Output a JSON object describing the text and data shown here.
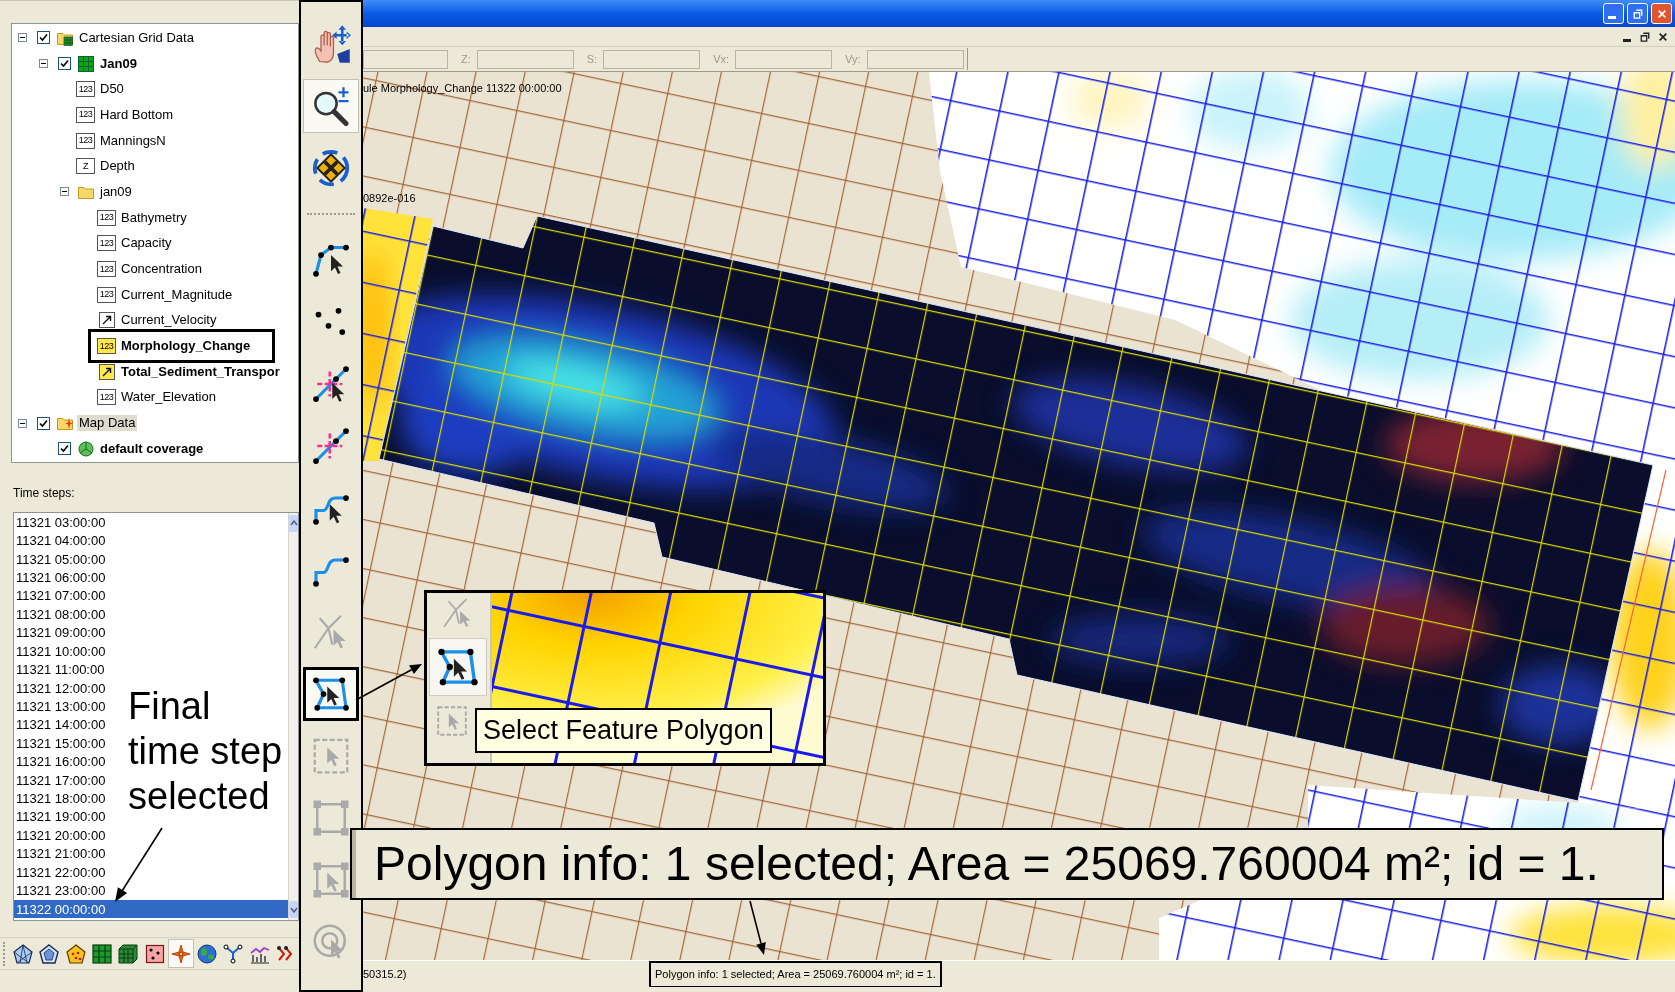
{
  "tree": [
    {
      "label": "Cartesian Grid Data",
      "kind": "grid_folder",
      "checked": true,
      "expanded": true,
      "active": false,
      "selected": false,
      "boxed": false,
      "children": [
        {
          "label": "Jan09",
          "kind": "grid",
          "checked": true,
          "expanded": true,
          "active": true,
          "selected": false,
          "boxed": false,
          "children": [
            {
              "label": "D50",
              "kind": "scalar",
              "icon_label": "123",
              "active": false,
              "selected": false,
              "boxed": false
            },
            {
              "label": "Hard Bottom",
              "kind": "scalar",
              "icon_label": "123",
              "active": false,
              "selected": false,
              "boxed": false
            },
            {
              "label": "ManningsN",
              "kind": "scalar",
              "icon_label": "123",
              "active": false,
              "selected": false,
              "boxed": false
            },
            {
              "label": "Depth",
              "kind": "elevation",
              "icon_label": "Z",
              "active": false,
              "selected": false,
              "boxed": false
            },
            {
              "label": "jan09",
              "kind": "folder",
              "expanded": true,
              "active": false,
              "selected": false,
              "boxed": false,
              "children": [
                {
                  "label": "Bathymetry",
                  "kind": "scalar",
                  "icon_label": "123",
                  "active": false,
                  "selected": false,
                  "boxed": false
                },
                {
                  "label": "Capacity",
                  "kind": "scalar",
                  "icon_label": "123",
                  "active": false,
                  "selected": false,
                  "boxed": false
                },
                {
                  "label": "Concentration",
                  "kind": "scalar",
                  "icon_label": "123",
                  "active": false,
                  "selected": false,
                  "boxed": false
                },
                {
                  "label": "Current_Magnitude",
                  "kind": "scalar",
                  "icon_label": "123",
                  "active": false,
                  "selected": false,
                  "boxed": false
                },
                {
                  "label": "Current_Velocity",
                  "kind": "vector",
                  "active": false,
                  "selected": false,
                  "boxed": false
                },
                {
                  "label": "Morphology_Change",
                  "kind": "scalar",
                  "icon_label": "123",
                  "active": true,
                  "selected": false,
                  "boxed": true
                },
                {
                  "label": "Total_Sediment_Transpor",
                  "kind": "vector",
                  "active": true,
                  "selected": false,
                  "boxed": false
                },
                {
                  "label": "Water_Elevation",
                  "kind": "scalar",
                  "icon_label": "123",
                  "active": false,
                  "selected": false,
                  "boxed": false
                }
              ]
            }
          ]
        }
      ]
    },
    {
      "label": "Map Data",
      "kind": "map_folder",
      "checked": true,
      "expanded": true,
      "active": false,
      "selected": true,
      "boxed": false,
      "children": [
        {
          "label": "default coverage",
          "kind": "coverage",
          "checked": true,
          "active": true,
          "selected": false,
          "boxed": false
        }
      ]
    }
  ],
  "time_steps": {
    "label": "Time steps:",
    "items": [
      {
        "text": "11321 03:00:00",
        "selected": false
      },
      {
        "text": "11321 04:00:00",
        "selected": false
      },
      {
        "text": "11321 05:00:00",
        "selected": false
      },
      {
        "text": "11321 06:00:00",
        "selected": false
      },
      {
        "text": "11321 07:00:00",
        "selected": false
      },
      {
        "text": "11321 08:00:00",
        "selected": false
      },
      {
        "text": "11321 09:00:00",
        "selected": false
      },
      {
        "text": "11321 10:00:00",
        "selected": false
      },
      {
        "text": "11321 11:00:00",
        "selected": false
      },
      {
        "text": "11321 12:00:00",
        "selected": false
      },
      {
        "text": "11321 13:00:00",
        "selected": false
      },
      {
        "text": "11321 14:00:00",
        "selected": false
      },
      {
        "text": "11321 15:00:00",
        "selected": false
      },
      {
        "text": "11321 16:00:00",
        "selected": false
      },
      {
        "text": "11321 17:00:00",
        "selected": false
      },
      {
        "text": "11321 18:00:00",
        "selected": false
      },
      {
        "text": "11321 19:00:00",
        "selected": false
      },
      {
        "text": "11321 20:00:00",
        "selected": false
      },
      {
        "text": "11321 21:00:00",
        "selected": false
      },
      {
        "text": "11321 22:00:00",
        "selected": false
      },
      {
        "text": "11321 23:00:00",
        "selected": false
      },
      {
        "text": "11322 00:00:00",
        "selected": true
      }
    ]
  },
  "module_toolbar": [
    {
      "kind": "mesh",
      "selected": false
    },
    {
      "kind": "mesh_outline",
      "selected": false
    },
    {
      "kind": "scatter_mesh",
      "selected": false
    },
    {
      "kind": "grid",
      "selected": false
    },
    {
      "kind": "grid_3d",
      "selected": false
    },
    {
      "kind": "scatter",
      "selected": false
    },
    {
      "kind": "map",
      "selected": true
    },
    {
      "kind": "gis",
      "selected": false
    },
    {
      "kind": "network",
      "selected": false
    },
    {
      "kind": "chart",
      "selected": false
    },
    {
      "kind": "particles",
      "selected": false
    }
  ],
  "tools": [
    {
      "kind": "pan",
      "selected": false,
      "disabled": false,
      "boxed": false
    },
    {
      "kind": "zoom",
      "selected": true,
      "disabled": false,
      "boxed": false
    },
    {
      "kind": "rotate",
      "selected": false,
      "disabled": false,
      "boxed": false
    },
    {
      "kind": "separator"
    },
    {
      "kind": "polyline_select",
      "selected": false,
      "disabled": false,
      "boxed": false
    },
    {
      "kind": "vertices",
      "selected": false,
      "disabled": false,
      "boxed": false
    },
    {
      "kind": "node_select",
      "selected": false,
      "disabled": false,
      "boxed": false
    },
    {
      "kind": "node",
      "selected": false,
      "disabled": false,
      "boxed": false
    },
    {
      "kind": "arc_select",
      "selected": false,
      "disabled": false,
      "boxed": false
    },
    {
      "kind": "arc",
      "selected": false,
      "disabled": false,
      "boxed": false
    },
    {
      "kind": "arc_group_select",
      "selected": false,
      "disabled": true,
      "boxed": false
    },
    {
      "kind": "polygon_select",
      "selected": true,
      "disabled": false,
      "boxed": true
    },
    {
      "kind": "dashed_select",
      "selected": false,
      "disabled": true,
      "boxed": false
    },
    {
      "kind": "square_nodes",
      "selected": false,
      "disabled": true,
      "boxed": false
    },
    {
      "kind": "square_select",
      "selected": false,
      "disabled": true,
      "boxed": false
    },
    {
      "kind": "circle_select",
      "selected": false,
      "disabled": true,
      "boxed": false
    }
  ],
  "coordinate_fields": [
    {
      "kind": "bare"
    },
    {
      "kind": "labeled",
      "label": "Z:"
    },
    {
      "kind": "labeled",
      "label": "S:"
    },
    {
      "kind": "labeled",
      "label": "Vx:"
    },
    {
      "kind": "labeled",
      "label": "Vy:"
    }
  ],
  "map": {
    "title": "ule Morphology_Change 11322 00:00:00",
    "value_text": "0892e-016"
  },
  "inset": {
    "tools": [
      {
        "kind": "arc_group_select",
        "selected": false,
        "disabled": true
      },
      {
        "kind": "polygon_select",
        "selected": true,
        "disabled": false
      },
      {
        "kind": "dashed_select",
        "selected": false,
        "disabled": true
      }
    ],
    "tooltip": "Select Feature Polygon"
  },
  "annotations": {
    "time_step_note": "Final time step selected",
    "polygon_info": "Polygon info: 1 selected; Area = 25069.760004 m²; id = 1."
  },
  "status_bar": {
    "coordinates": "50315.2)",
    "message": "Polygon info: 1 selected; Area = 25069.760004 m²; id = 1."
  }
}
